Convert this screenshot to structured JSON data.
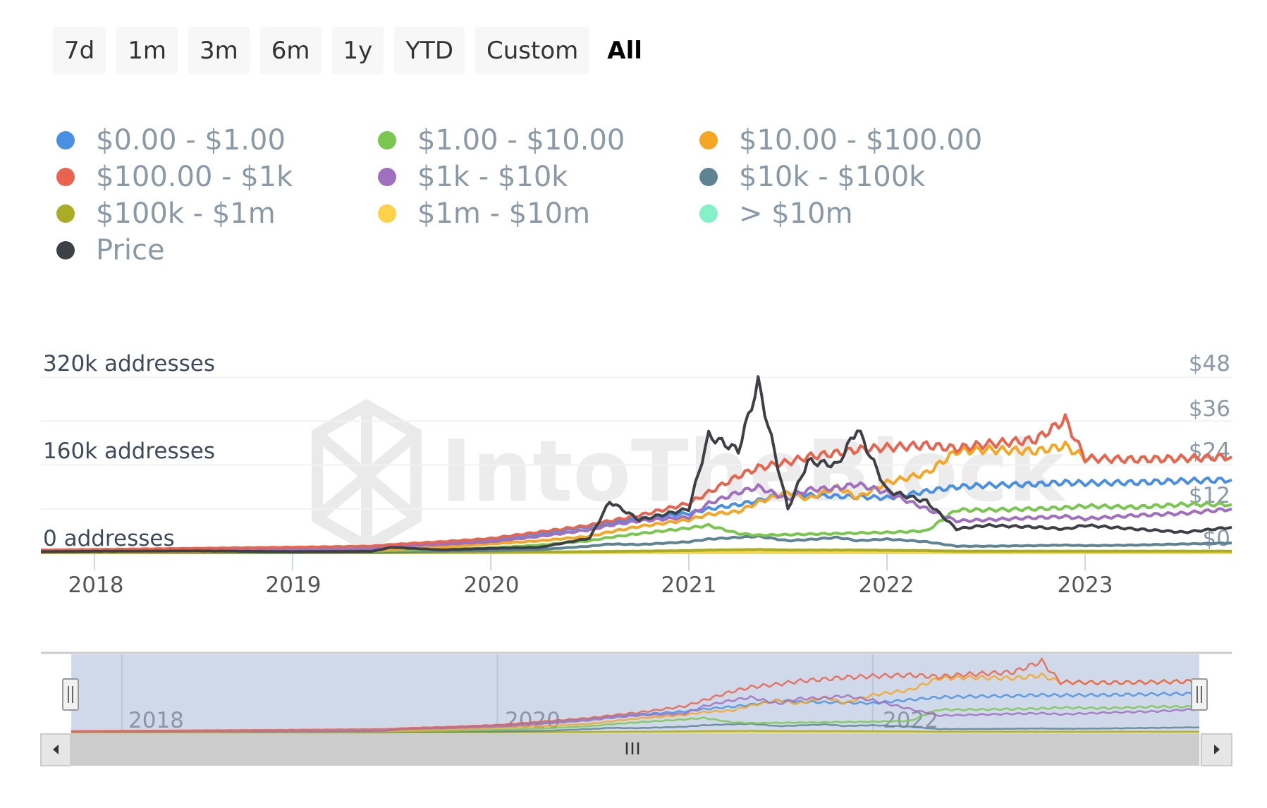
{
  "range_selector": {
    "buttons": [
      {
        "label": "7d",
        "active": false
      },
      {
        "label": "1m",
        "active": false
      },
      {
        "label": "3m",
        "active": false
      },
      {
        "label": "6m",
        "active": false
      },
      {
        "label": "1y",
        "active": false
      },
      {
        "label": "YTD",
        "active": false
      },
      {
        "label": "Custom",
        "active": false
      },
      {
        "label": "All",
        "active": true
      }
    ]
  },
  "watermark": "IntoTheBlock",
  "chart_data": {
    "type": "line",
    "title": "",
    "xlabel": "",
    "ylabel": "addresses",
    "y2label": "Price",
    "legend_position": "top-left",
    "grid": true,
    "xlim": [
      2017.73,
      2023.74
    ],
    "ylim": [
      0,
      320000
    ],
    "y2lim": [
      0,
      48
    ],
    "x_ticks": [
      "2018",
      "2019",
      "2020",
      "2021",
      "2022",
      "2023"
    ],
    "y_ticks": [
      "0 addresses",
      "160k addresses",
      "320k addresses"
    ],
    "y2_ticks": [
      "$0",
      "$12",
      "$24",
      "$36",
      "$48"
    ],
    "navigator_ticks": [
      "2018",
      "2020",
      "2022"
    ],
    "x": [
      2017.73,
      2018.0,
      2018.5,
      2019.0,
      2019.4,
      2019.5,
      2019.75,
      2020.0,
      2020.25,
      2020.5,
      2020.6,
      2020.75,
      2021.0,
      2021.1,
      2021.25,
      2021.35,
      2021.5,
      2021.6,
      2021.75,
      2021.85,
      2022.0,
      2022.2,
      2022.35,
      2022.5,
      2022.75,
      2022.9,
      2023.0,
      2023.25,
      2023.5,
      2023.74
    ],
    "series": [
      {
        "name": "$0.00 - $1.00",
        "color": "#4a90e2",
        "axis": "left",
        "values": [
          2000,
          3000,
          4000,
          5000,
          7000,
          12000,
          18000,
          25000,
          35000,
          48000,
          55000,
          62000,
          72000,
          80000,
          88000,
          95000,
          110000,
          105000,
          103000,
          102000,
          100000,
          112000,
          120000,
          123000,
          125000,
          128000,
          127000,
          128000,
          131000,
          133000
        ]
      },
      {
        "name": "$1.00 - $10.00",
        "color": "#7ac74f",
        "axis": "left",
        "values": [
          1000,
          1000,
          1500,
          2000,
          3000,
          4000,
          6000,
          9000,
          14000,
          22000,
          28000,
          35000,
          45000,
          50000,
          35000,
          32000,
          33000,
          34000,
          35000,
          36000,
          37000,
          40000,
          78000,
          78000,
          80000,
          82000,
          85000,
          83000,
          88000,
          88000
        ]
      },
      {
        "name": "$10.00 - $100.00",
        "color": "#f5a623",
        "axis": "left",
        "values": [
          1000,
          1500,
          2000,
          3000,
          4000,
          6000,
          10000,
          16000,
          22000,
          30000,
          38000,
          48000,
          60000,
          70000,
          75000,
          92000,
          110000,
          98000,
          120000,
          100000,
          128000,
          145000,
          185000,
          188000,
          185000,
          195000,
          172000,
          170000,
          172000,
          175000
        ]
      },
      {
        "name": "$100.00 - $1k",
        "color": "#e8644f",
        "axis": "left",
        "values": [
          5000,
          6000,
          8000,
          10000,
          12000,
          15000,
          20000,
          26000,
          38000,
          50000,
          58000,
          68000,
          90000,
          110000,
          140000,
          155000,
          165000,
          175000,
          182000,
          188000,
          192000,
          196000,
          190000,
          198000,
          206000,
          243000,
          172000,
          170000,
          172000,
          175000
        ]
      },
      {
        "name": "$1k - $10k",
        "color": "#a06fc0",
        "axis": "left",
        "values": [
          3000,
          3500,
          4000,
          4000,
          6000,
          12000,
          15000,
          20000,
          30000,
          42000,
          50000,
          58000,
          65000,
          90000,
          110000,
          120000,
          98000,
          115000,
          118000,
          125000,
          110000,
          80000,
          58000,
          60000,
          64000,
          66000,
          62000,
          68000,
          72000,
          80000
        ]
      },
      {
        "name": "$10k - $100k",
        "color": "#5e8494",
        "axis": "left",
        "values": [
          500,
          800,
          1000,
          1000,
          1500,
          2000,
          3000,
          4000,
          6000,
          12000,
          16000,
          15000,
          20000,
          25000,
          28000,
          30000,
          22000,
          24000,
          28000,
          22000,
          25000,
          20000,
          12000,
          12000,
          13000,
          14000,
          13000,
          14000,
          16000,
          18000
        ]
      },
      {
        "name": "$100k - $1m",
        "color": "#a9ad25",
        "axis": "left",
        "values": [
          0,
          0,
          0,
          0,
          0,
          500,
          800,
          1000,
          1500,
          2000,
          2500,
          3000,
          4000,
          5000,
          5500,
          6000,
          5000,
          5000,
          5000,
          5000,
          4500,
          4000,
          3000,
          3000,
          3000,
          3000,
          3000,
          3000,
          3000,
          3000
        ]
      },
      {
        "name": "$1m - $10m",
        "color": "#fed14b",
        "axis": "left",
        "values": [
          0,
          0,
          0,
          0,
          0,
          0,
          0,
          0,
          200,
          300,
          400,
          500,
          600,
          700,
          800,
          900,
          800,
          800,
          800,
          800,
          700,
          600,
          500,
          500,
          500,
          500,
          500,
          500,
          500,
          500
        ]
      },
      {
        "name": "> $10m",
        "color": "#86f0c8",
        "axis": "left",
        "values": [
          200,
          800,
          200,
          200,
          200,
          200,
          200,
          200,
          200,
          200,
          200,
          200,
          200,
          200,
          200,
          200,
          200,
          200,
          200,
          200,
          200,
          200,
          200,
          200,
          200,
          200,
          200,
          200,
          200,
          200
        ]
      },
      {
        "name": "Price",
        "color": "#3d4045",
        "axis": "right",
        "values": [
          0.3,
          0.4,
          0.5,
          0.3,
          0.4,
          1.5,
          0.8,
          1.2,
          1.5,
          4.0,
          14.0,
          9.0,
          12.0,
          32.0,
          28.0,
          46.5,
          12.0,
          25.0,
          24.0,
          34.0,
          17.0,
          14.0,
          6.5,
          7.5,
          7.0,
          6.5,
          7.5,
          6.5,
          5.6,
          7.0
        ]
      }
    ]
  }
}
